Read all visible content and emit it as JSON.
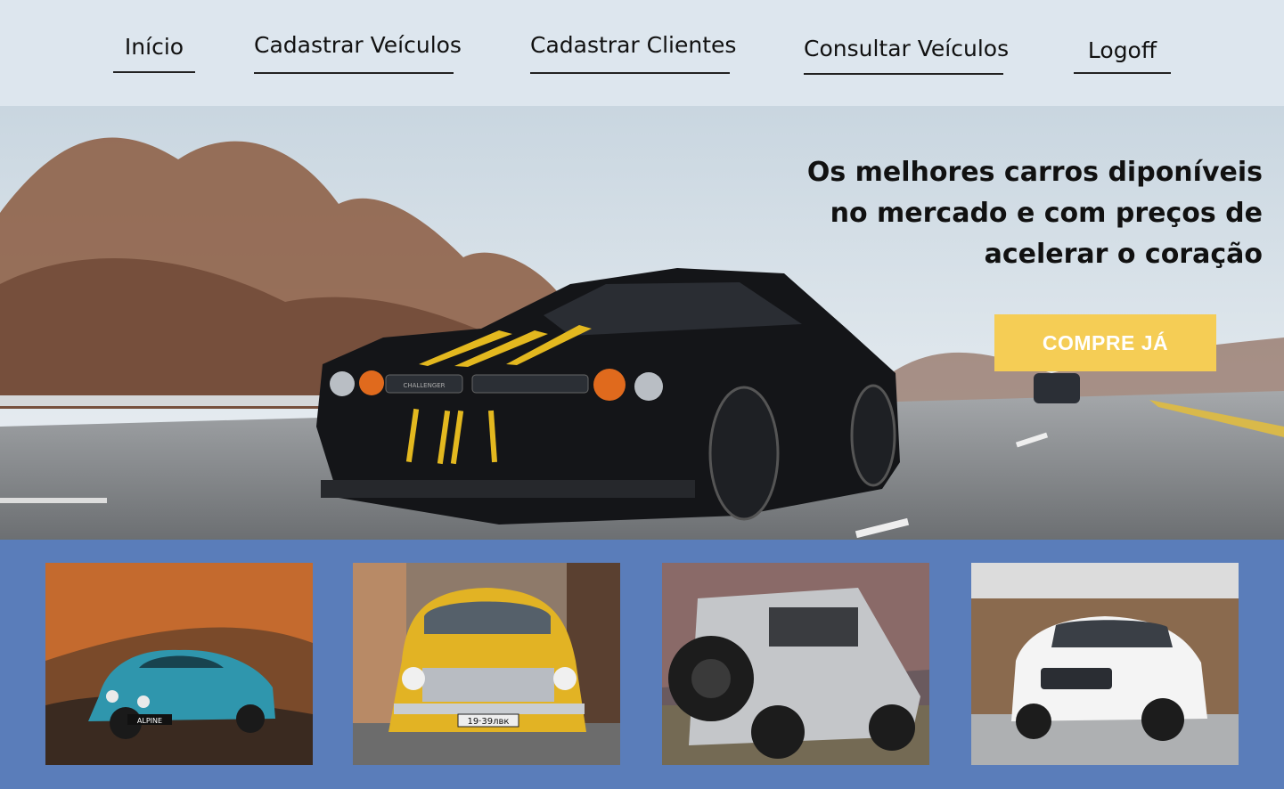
{
  "nav": {
    "items": [
      {
        "label": "Início"
      },
      {
        "label": "Cadastrar Veículos"
      },
      {
        "label": "Cadastrar Clientes"
      },
      {
        "label": "Consultar Veículos"
      },
      {
        "label": "Logoff"
      }
    ]
  },
  "hero": {
    "title": "Os melhores carros diponíveis no mercado e com preços de acelerar o coração",
    "cta_label": "COMPRE JÁ",
    "plate_text": "CHALLENGER"
  },
  "gallery": {
    "cards": [
      {
        "plate_text": "ALPINE",
        "icon": "vintage-sports-car"
      },
      {
        "plate_text": "19·39лвк",
        "icon": "vintage-sedan"
      },
      {
        "plate_text": "",
        "icon": "off-road-jeep"
      },
      {
        "plate_text": "",
        "icon": "white-suv"
      }
    ]
  },
  "colors": {
    "nav_background": "#dde6ee",
    "accent_button": "#f5cd55",
    "gallery_background": "#5a7dba"
  }
}
